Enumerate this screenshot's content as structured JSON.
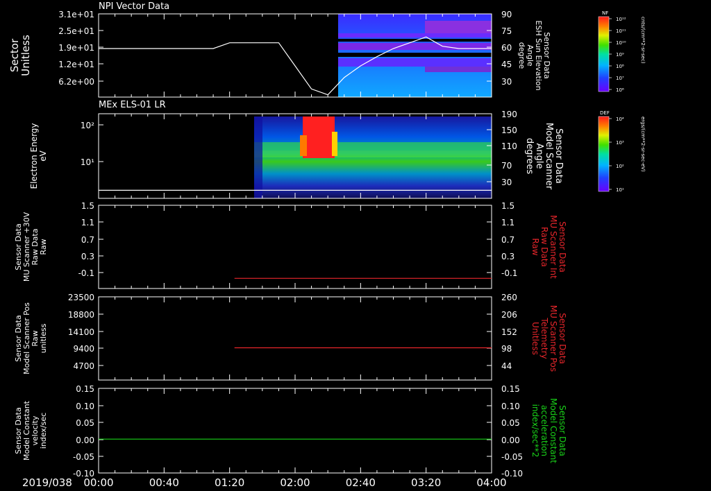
{
  "date_label": "2019/038",
  "time_ticks": [
    "00:00",
    "00:40",
    "01:20",
    "02:00",
    "02:40",
    "03:20",
    "04:00"
  ],
  "colors": {
    "background": "#000000",
    "axis": "#ffffff",
    "red_trace": "#e8262b",
    "green_trace": "#19d419"
  },
  "panels": [
    {
      "title": "NPI Vector Data",
      "left_label": [
        "Sector",
        "Unitless"
      ],
      "right_label": [
        "Sensor Data",
        "ESH Sun Elevation",
        "Angle",
        "degree"
      ],
      "right_label_color": "#ffffff",
      "left_ticks": [
        "3.1e+01",
        "2.5e+01",
        "1.9e+01",
        "1.2e+01",
        "6.2e+00"
      ],
      "right_ticks": [
        "90",
        "75",
        "60",
        "45",
        "30"
      ]
    },
    {
      "title": "MEx ELS-01 LR",
      "left_label": [
        "Electron Energy",
        "eV"
      ],
      "right_label": [
        "Sensor Data",
        "Model Scanner",
        "Angle",
        "degrees"
      ],
      "right_label_color": "#ffffff",
      "left_ticks": [
        "10²",
        "10¹"
      ],
      "right_ticks": [
        "190",
        "150",
        "110",
        "70",
        "30"
      ]
    },
    {
      "title": "",
      "left_label": [
        "Sensor Data",
        "MU Scanner +30V",
        "Raw Data",
        "Raw"
      ],
      "right_label": [
        "Sensor Data",
        "MU Scanner Int",
        "Raw Data",
        "Raw"
      ],
      "right_label_color": "#e8262b",
      "left_ticks": [
        "1.5",
        "1.1",
        "0.7",
        "0.3",
        "-0.1"
      ],
      "right_ticks": [
        "1.5",
        "1.1",
        "0.7",
        "0.3",
        "-0.1"
      ]
    },
    {
      "title": "",
      "left_label": [
        "Sensor Data",
        "Model Scanner Pos",
        "Raw",
        "unitless"
      ],
      "right_label": [
        "Sensor Data",
        "MU Scanner Pos",
        "Telemetry",
        "Unitless"
      ],
      "right_label_color": "#e8262b",
      "left_ticks": [
        "23500",
        "18800",
        "14100",
        "9400",
        "4700"
      ],
      "right_ticks": [
        "260",
        "206",
        "152",
        "98",
        "44"
      ]
    },
    {
      "title": "",
      "left_label": [
        "Sensor Data",
        "Model Constant",
        "velocity",
        "index/sec"
      ],
      "right_label": [
        "Sensor Data",
        "Model Constant",
        "acceleration",
        "index/sec**2"
      ],
      "right_label_color": "#19d419",
      "left_ticks": [
        "0.15",
        "0.10",
        "0.05",
        "0.00",
        "-0.05",
        "-0.10"
      ],
      "right_ticks": [
        "0.15",
        "0.10",
        "0.05",
        "0.00",
        "-0.05",
        "-0.10"
      ]
    }
  ],
  "colorbars": [
    {
      "title": "NF",
      "unit_label": "cnts/(cm**2-sr-sec)",
      "ticks": [
        "10¹²",
        "10¹¹",
        "10¹⁰",
        "10⁹",
        "10⁸",
        "10⁷",
        "10⁶"
      ]
    },
    {
      "title": "DEF",
      "unit_label": "ergs/(cm**2-sr-sec-eV)",
      "ticks": [
        "10⁴",
        "10³",
        "10²",
        "10¹"
      ]
    }
  ],
  "chart_data": [
    {
      "type": "line",
      "panel": 0,
      "series": [
        {
          "axis": "right",
          "x": [
            "00:00",
            "00:30",
            "01:00",
            "01:10",
            "01:20",
            "01:40",
            "01:50",
            "02:00",
            "02:10",
            "02:20",
            "02:30",
            "02:40",
            "02:50",
            "03:00",
            "03:10",
            "03:20",
            "03:30",
            "03:40",
            "04:00"
          ],
          "values": [
            60,
            60,
            60,
            60,
            65,
            65,
            65,
            45,
            25,
            20,
            35,
            45,
            53,
            60,
            65,
            70,
            62,
            60,
            60
          ]
        }
      ],
      "ylim_right": [
        18,
        90
      ]
    },
    {
      "type": "heatmap",
      "panel": 0,
      "x_range": [
        "02:26",
        "04:00"
      ],
      "note_visible": "sector spectrogram, high sectors near top purple/magenta bands"
    },
    {
      "type": "heatmap",
      "panel": 1,
      "x_range": [
        "01:26",
        "04:00"
      ],
      "energy_range_ev": [
        2,
        160
      ]
    },
    {
      "type": "line",
      "panel": 1,
      "series": [
        {
          "axis": "right",
          "x": [
            "00:00",
            "04:00"
          ],
          "values": [
            18,
            18
          ]
        }
      ]
    },
    {
      "type": "line",
      "panel": 2,
      "series": [
        {
          "axis": "left",
          "x": [
            "01:23",
            "04:00"
          ],
          "values": [
            -0.08,
            -0.08
          ],
          "color": "#e8262b"
        }
      ],
      "ylim": [
        -0.3,
        1.5
      ]
    },
    {
      "type": "line",
      "panel": 3,
      "series": [
        {
          "axis": "left",
          "x": [
            "01:23",
            "04:00"
          ],
          "values": [
            9100,
            9100
          ],
          "color": "#e8262b"
        }
      ],
      "ylim": [
        0,
        23500
      ]
    },
    {
      "type": "line",
      "panel": 4,
      "series": [
        {
          "axis": "left",
          "x": [
            "00:00",
            "04:00"
          ],
          "values": [
            0,
            0
          ],
          "color": "#19d419"
        }
      ],
      "ylim": [
        -0.1,
        0.15
      ]
    }
  ]
}
